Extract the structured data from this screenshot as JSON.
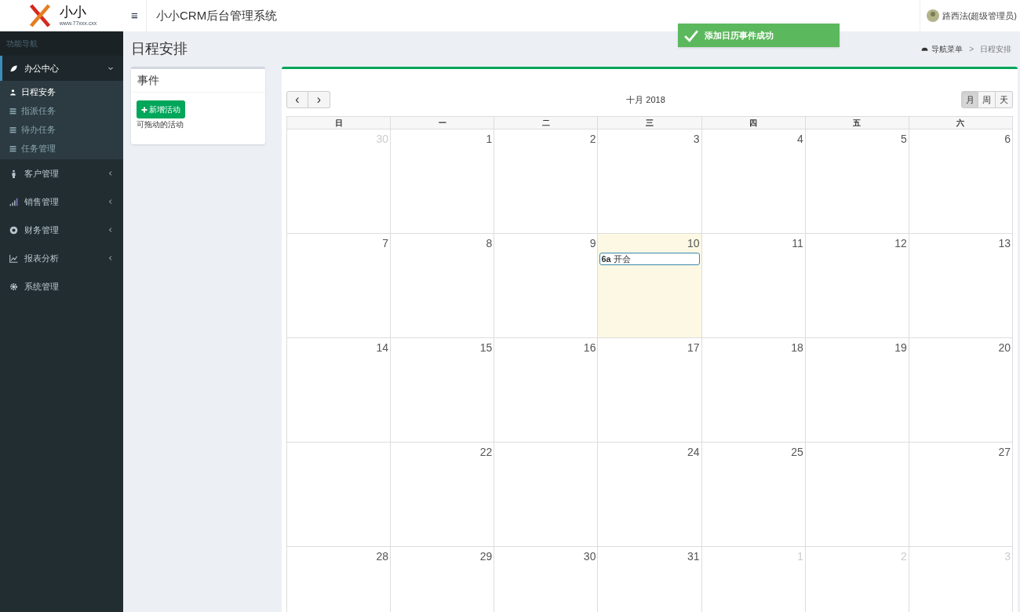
{
  "logo": {
    "text": "小小",
    "subtext": "www.77xxx.cxx"
  },
  "header": {
    "menu_toggle": "≡",
    "title": "小小CRM后台管理系统",
    "user": "路西法(超级管理员)"
  },
  "toast": {
    "message": "添加日历事件成功"
  },
  "sidebar": {
    "heading": "功能导航",
    "items": [
      {
        "label": "办公中心",
        "kind": "leaf",
        "expanded": true,
        "children": [
          {
            "label": "日程安务",
            "kind": "user",
            "selected": true
          },
          {
            "label": "指派任务",
            "kind": "list",
            "selected": false
          },
          {
            "label": "待办任务",
            "kind": "list",
            "selected": false
          },
          {
            "label": "任务管理",
            "kind": "list",
            "selected": false
          }
        ]
      },
      {
        "label": "客户管理",
        "kind": "person",
        "expanded": false
      },
      {
        "label": "销售管理",
        "kind": "signal",
        "expanded": false
      },
      {
        "label": "财务管理",
        "kind": "coin",
        "expanded": false
      },
      {
        "label": "报表分析",
        "kind": "chart",
        "expanded": false
      },
      {
        "label": "系统管理",
        "kind": "gear"
      }
    ]
  },
  "page": {
    "title": "日程安排",
    "breadcrumb": [
      "导航菜单",
      "日程安排"
    ],
    "breadcrumb_separator": ">"
  },
  "events_panel": {
    "title": "事件",
    "add_button": "新增活动",
    "hint": "可拖动的活动"
  },
  "calendar": {
    "prev": "‹",
    "next": "›",
    "title": "十月 2018",
    "views": [
      {
        "label": "月",
        "selected": true
      },
      {
        "label": "周",
        "selected": false
      },
      {
        "label": "天",
        "selected": false
      }
    ],
    "weekdays": [
      "日",
      "一",
      "二",
      "三",
      "四",
      "五",
      "六"
    ],
    "weeks": [
      [
        {
          "day": "30",
          "other": true
        },
        {
          "day": "1"
        },
        {
          "day": "2"
        },
        {
          "day": "3"
        },
        {
          "day": "4"
        },
        {
          "day": "5"
        },
        {
          "day": "6"
        }
      ],
      [
        {
          "day": "7"
        },
        {
          "day": "8"
        },
        {
          "day": "9"
        },
        {
          "day": "10",
          "today": true,
          "events": [
            {
              "time": "6a",
              "title": "开会"
            }
          ]
        },
        {
          "day": "11"
        },
        {
          "day": "12"
        },
        {
          "day": "13"
        }
      ],
      [
        {
          "day": "14"
        },
        {
          "day": "15"
        },
        {
          "day": "16"
        },
        {
          "day": "17"
        },
        {
          "day": "18"
        },
        {
          "day": "19"
        },
        {
          "day": "20"
        }
      ],
      [
        {
          "blank": true
        },
        {
          "day": "22"
        },
        {
          "blank": true
        },
        {
          "day": "24"
        },
        {
          "day": "25"
        },
        {
          "blank": true
        },
        {
          "day": "27"
        }
      ],
      [
        {
          "day": "28"
        },
        {
          "day": "29"
        },
        {
          "day": "30"
        },
        {
          "day": "31"
        },
        {
          "day": "1",
          "other": true
        },
        {
          "day": "2",
          "other": true
        },
        {
          "day": "3",
          "other": true
        }
      ]
    ]
  }
}
